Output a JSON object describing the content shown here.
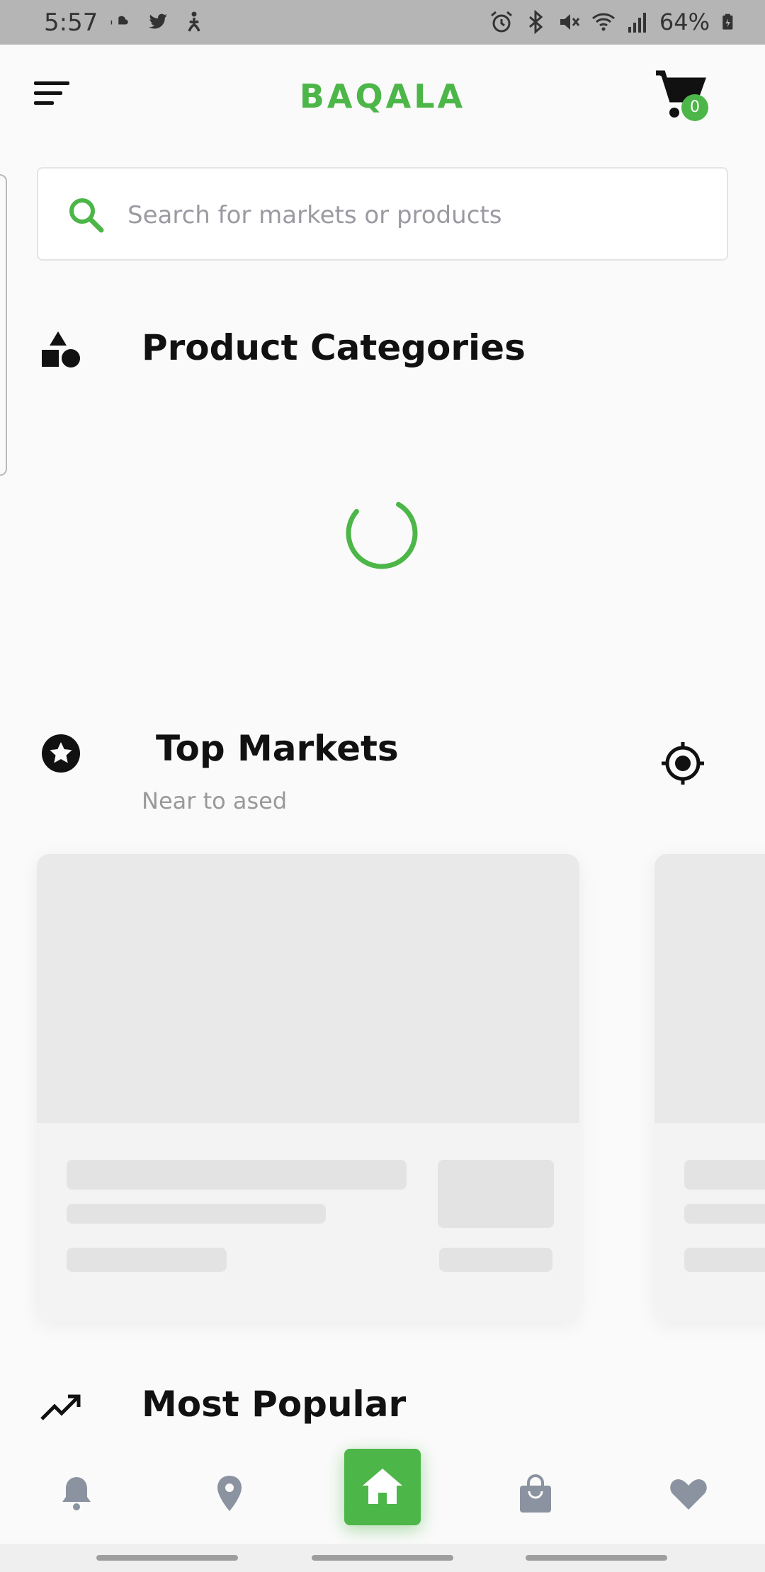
{
  "status_bar": {
    "time": "5:57",
    "battery": "64%",
    "left_icons": [
      "soundcloud-icon",
      "twitter-icon",
      "accessibility-icon"
    ],
    "right_icons": [
      "alarm-icon",
      "bluetooth-icon",
      "mute-icon",
      "wifi-icon",
      "signal-icon",
      "battery-icon"
    ]
  },
  "app_bar": {
    "title": "BAQALA",
    "cart_count": "0"
  },
  "search": {
    "placeholder": "Search for markets or products"
  },
  "sections": {
    "categories": {
      "title": "Product Categories",
      "icon": "shapes-icon",
      "loading": true
    },
    "top_markets": {
      "title": "Top Markets",
      "subtitle": "Near to ased",
      "icon": "star-circle-icon"
    },
    "most_popular": {
      "title": "Most Popular",
      "icon": "trending-up-icon"
    }
  },
  "bottom_nav": {
    "items": [
      "notifications-icon",
      "location-pin-icon",
      "home-icon",
      "shopping-bag-icon",
      "heart-icon"
    ],
    "active": "home-icon"
  },
  "colors": {
    "accent": "#4cb648",
    "background": "#fafafa",
    "nav_icon": "#8b93a0",
    "skeleton": "#e3e3e3"
  }
}
